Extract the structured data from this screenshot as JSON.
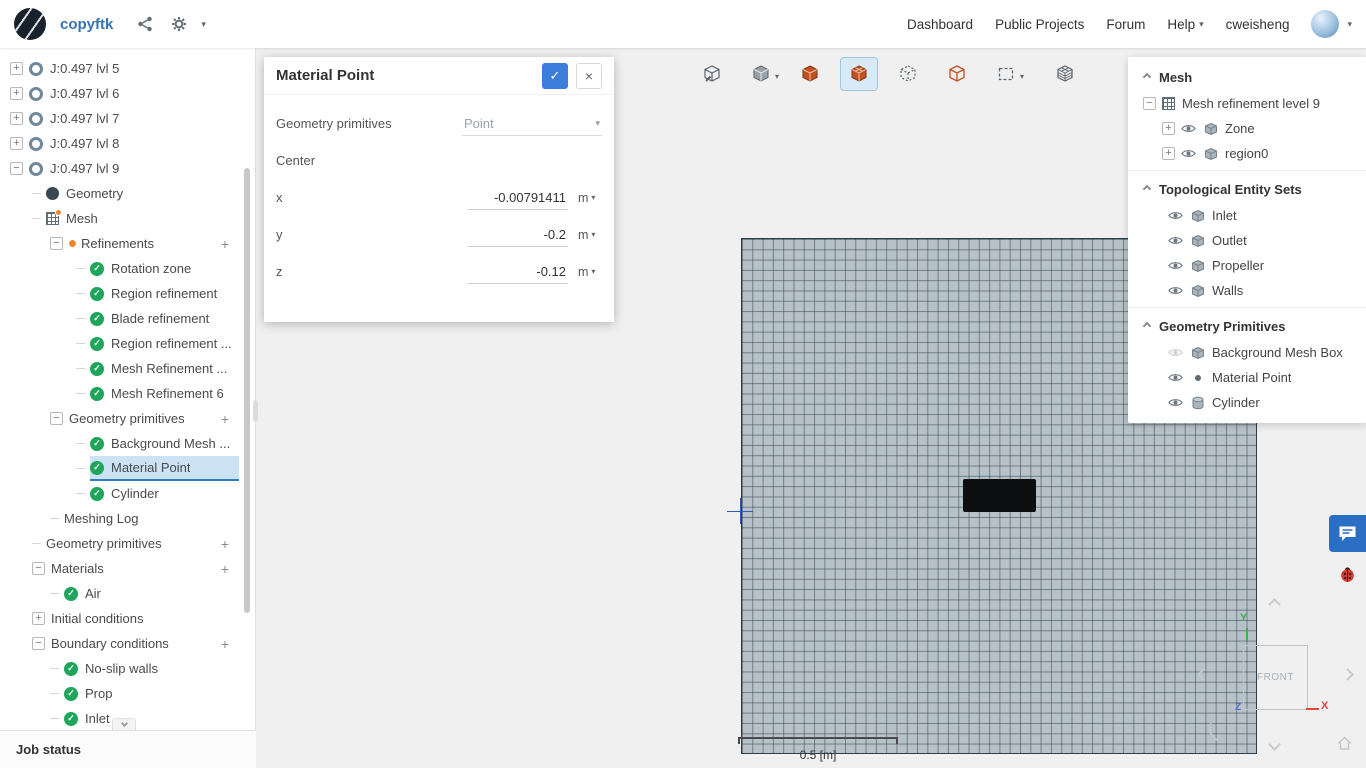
{
  "colors": {
    "accent_blue": "#3b7dd8",
    "brand_blue": "#3572b0",
    "check_green": "#1ea65a",
    "selection_blue": "#cce3f6",
    "toolbar_orange": "#c35020",
    "chat_blue": "#2b6fc4",
    "mesh_fill": "#b6c2c8"
  },
  "icons": {
    "check": "✓",
    "plus": "+",
    "minus": "−",
    "caret_down": "▾",
    "close": "×"
  },
  "topbar": {
    "project_title": "copyftk",
    "nav": [
      "Dashboard",
      "Public Projects",
      "Forum",
      "Help"
    ],
    "username": "cweisheng"
  },
  "sidebar": {
    "tree": [
      {
        "label": "J:0.497 lvl 5"
      },
      {
        "label": "J:0.497 lvl 6"
      },
      {
        "label": "J:0.497 lvl 7"
      },
      {
        "label": "J:0.497 lvl 8"
      },
      {
        "label": "J:0.497 lvl 9"
      },
      {
        "label": "Geometry"
      },
      {
        "label": "Mesh"
      },
      {
        "label": "Refinements"
      },
      {
        "label": "Rotation zone"
      },
      {
        "label": "Region refinement"
      },
      {
        "label": "Blade refinement"
      },
      {
        "label": "Region refinement ..."
      },
      {
        "label": "Mesh Refinement ..."
      },
      {
        "label": "Mesh Refinement 6"
      },
      {
        "label": "Geometry primitives"
      },
      {
        "label": "Background Mesh ..."
      },
      {
        "label": "Material Point"
      },
      {
        "label": "Cylinder"
      },
      {
        "label": "Meshing Log"
      },
      {
        "label": "Geometry primitives"
      },
      {
        "label": "Materials"
      },
      {
        "label": "Air"
      },
      {
        "label": "Initial conditions"
      },
      {
        "label": "Boundary conditions"
      },
      {
        "label": "No-slip walls"
      },
      {
        "label": "Prop"
      },
      {
        "label": "Inlet"
      }
    ],
    "job_status_label": "Job status"
  },
  "dialog": {
    "title": "Material Point",
    "geometry_primitives_label": "Geometry primitives",
    "geometry_primitives_value": "Point",
    "center_label": "Center",
    "x_label": "x",
    "x_value": "-0.00791411",
    "x_unit": "m",
    "y_label": "y",
    "y_value": "-0.2",
    "y_unit": "m",
    "z_label": "z",
    "z_value": "-0.12",
    "z_unit": "m"
  },
  "scene": {
    "sections": [
      {
        "title": "Mesh",
        "items": [
          {
            "label": "Mesh refinement level 9"
          },
          {
            "label": "Zone"
          },
          {
            "label": "region0"
          }
        ]
      },
      {
        "title": "Topological Entity Sets",
        "items": [
          {
            "label": "Inlet"
          },
          {
            "label": "Outlet"
          },
          {
            "label": "Propeller"
          },
          {
            "label": "Walls"
          }
        ]
      },
      {
        "title": "Geometry Primitives",
        "items": [
          {
            "label": "Background Mesh Box"
          },
          {
            "label": "Material Point"
          },
          {
            "label": "Cylinder"
          }
        ]
      }
    ]
  },
  "viewport": {
    "scale_label": "0.5 [m]",
    "orientation_label": "FRONT",
    "axis_x": "X",
    "axis_y": "Y",
    "axis_z": "Z"
  }
}
